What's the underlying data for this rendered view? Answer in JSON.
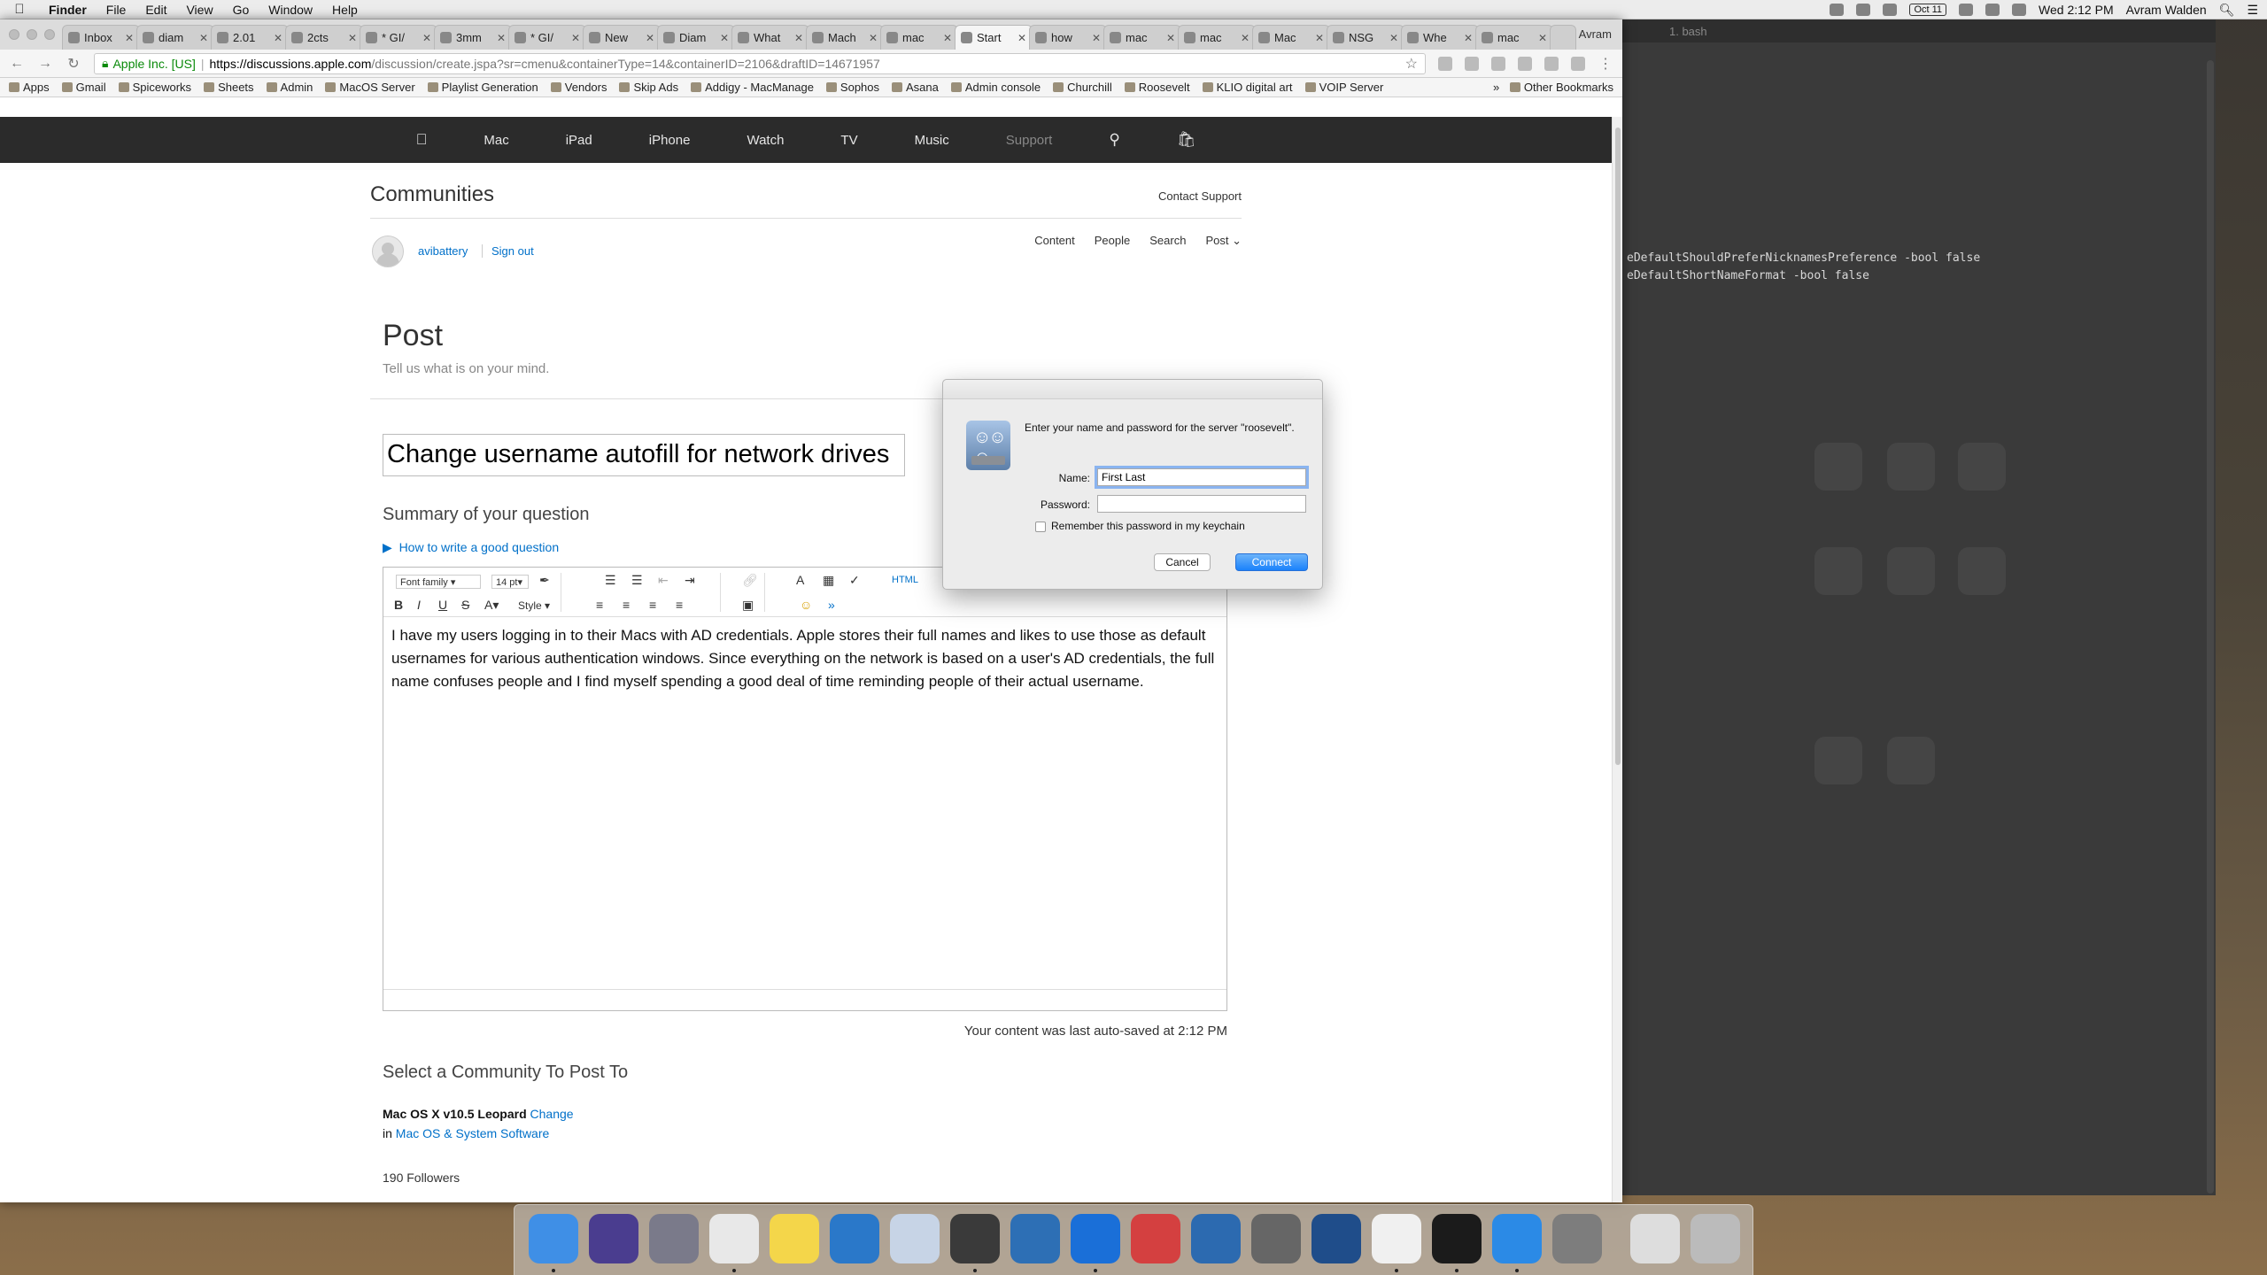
{
  "menubar": {
    "app": "Finder",
    "items": [
      "File",
      "Edit",
      "View",
      "Go",
      "Window",
      "Help"
    ],
    "date_badge": "Oct 11",
    "clock": "Wed 2:12 PM",
    "user": "Avram Walden"
  },
  "browser": {
    "tabs": [
      {
        "label": "Inbox",
        "active": false
      },
      {
        "label": "diam",
        "active": false
      },
      {
        "label": "2.01",
        "active": false
      },
      {
        "label": "2cts",
        "active": false
      },
      {
        "label": "* GI/",
        "active": false
      },
      {
        "label": "3mm",
        "active": false
      },
      {
        "label": "* GI/",
        "active": false
      },
      {
        "label": "New",
        "active": false
      },
      {
        "label": "Diam",
        "active": false
      },
      {
        "label": "What",
        "active": false
      },
      {
        "label": "Mach",
        "active": false
      },
      {
        "label": "mac",
        "active": false
      },
      {
        "label": "Start",
        "active": true
      },
      {
        "label": "how",
        "active": false
      },
      {
        "label": "mac",
        "active": false
      },
      {
        "label": "mac",
        "active": false
      },
      {
        "label": "Mac",
        "active": false
      },
      {
        "label": "NSG",
        "active": false
      },
      {
        "label": "Whe",
        "active": false
      },
      {
        "label": "mac",
        "active": false
      }
    ],
    "profile": "Avram",
    "secure_label": "Apple Inc. [US]",
    "url_host": "https://discussions.apple.com",
    "url_path": "/discussion/create.jspa?sr=cmenu&containerType=14&containerID=2106&draftID=14671957",
    "bookmarks": [
      "Apps",
      "Gmail",
      "Spiceworks",
      "Sheets",
      "Admin",
      "MacOS Server",
      "Playlist Generation",
      "Vendors",
      "Skip Ads",
      "Addigy - MacManage",
      "Sophos",
      "Asana",
      "Admin console",
      "Churchill",
      "Roosevelt",
      "KLIO digital art",
      "VOIP Server"
    ],
    "other_bookmarks": "Other Bookmarks"
  },
  "gnav": {
    "items": [
      "Mac",
      "iPad",
      "iPhone",
      "Watch",
      "TV",
      "Music",
      "Support"
    ]
  },
  "page": {
    "communities": "Communities",
    "contact_support": "Contact Support",
    "username": "avibattery",
    "sign_out": "Sign out",
    "subnav": [
      "Content",
      "People",
      "Search",
      "Post"
    ],
    "post_heading": "Post",
    "post_sub": "Tell us what is on your mind.",
    "subject": "Change username autofill for network drives",
    "summary_heading": "Summary of your question",
    "how_to": "How to write a good question",
    "toolbar": {
      "font_family": "Font family",
      "font_size": "14 pt",
      "style": "Style",
      "html": "HTML"
    },
    "body": "I have my users logging in to their Macs with AD credentials. Apple stores their full names and likes to use those as default usernames for various authentication windows. Since everything on the network is based on a user's AD credentials, the full name confuses people and I find myself spending a good deal of time reminding people of their actual username.",
    "autosave": "Your content was last auto-saved at 2:12 PM",
    "select_heading": "Select a Community To Post To",
    "community_name": "Mac OS X v10.5 Leopard",
    "change": "Change",
    "in_label": "in",
    "community_parent": "Mac OS & System Software",
    "followers": "190 Followers"
  },
  "dialog": {
    "message": "Enter your name and password for the server \"roosevelt\".",
    "name_label": "Name:",
    "name_value": "First Last",
    "password_label": "Password:",
    "remember": "Remember this password in my keychain",
    "cancel": "Cancel",
    "connect": "Connect"
  },
  "terminal": {
    "title": "1. bash",
    "lines": [
      "eDefaultShouldPreferNicknamesPreference -bool false",
      "eDefaultShortNameFormat -bool false"
    ]
  },
  "dock": {
    "apps": [
      "finder",
      "siri",
      "launchpad",
      "chrome",
      "notes",
      "vectorworks",
      "preview",
      "sublime-text",
      "wireshark",
      "teamviewer",
      "remote-desktop",
      "remote-desktop-manager",
      "network-utility",
      "virtualbox",
      "sketch",
      "terminal",
      "app-store",
      "system-preferences",
      "torrent",
      "trash"
    ]
  }
}
